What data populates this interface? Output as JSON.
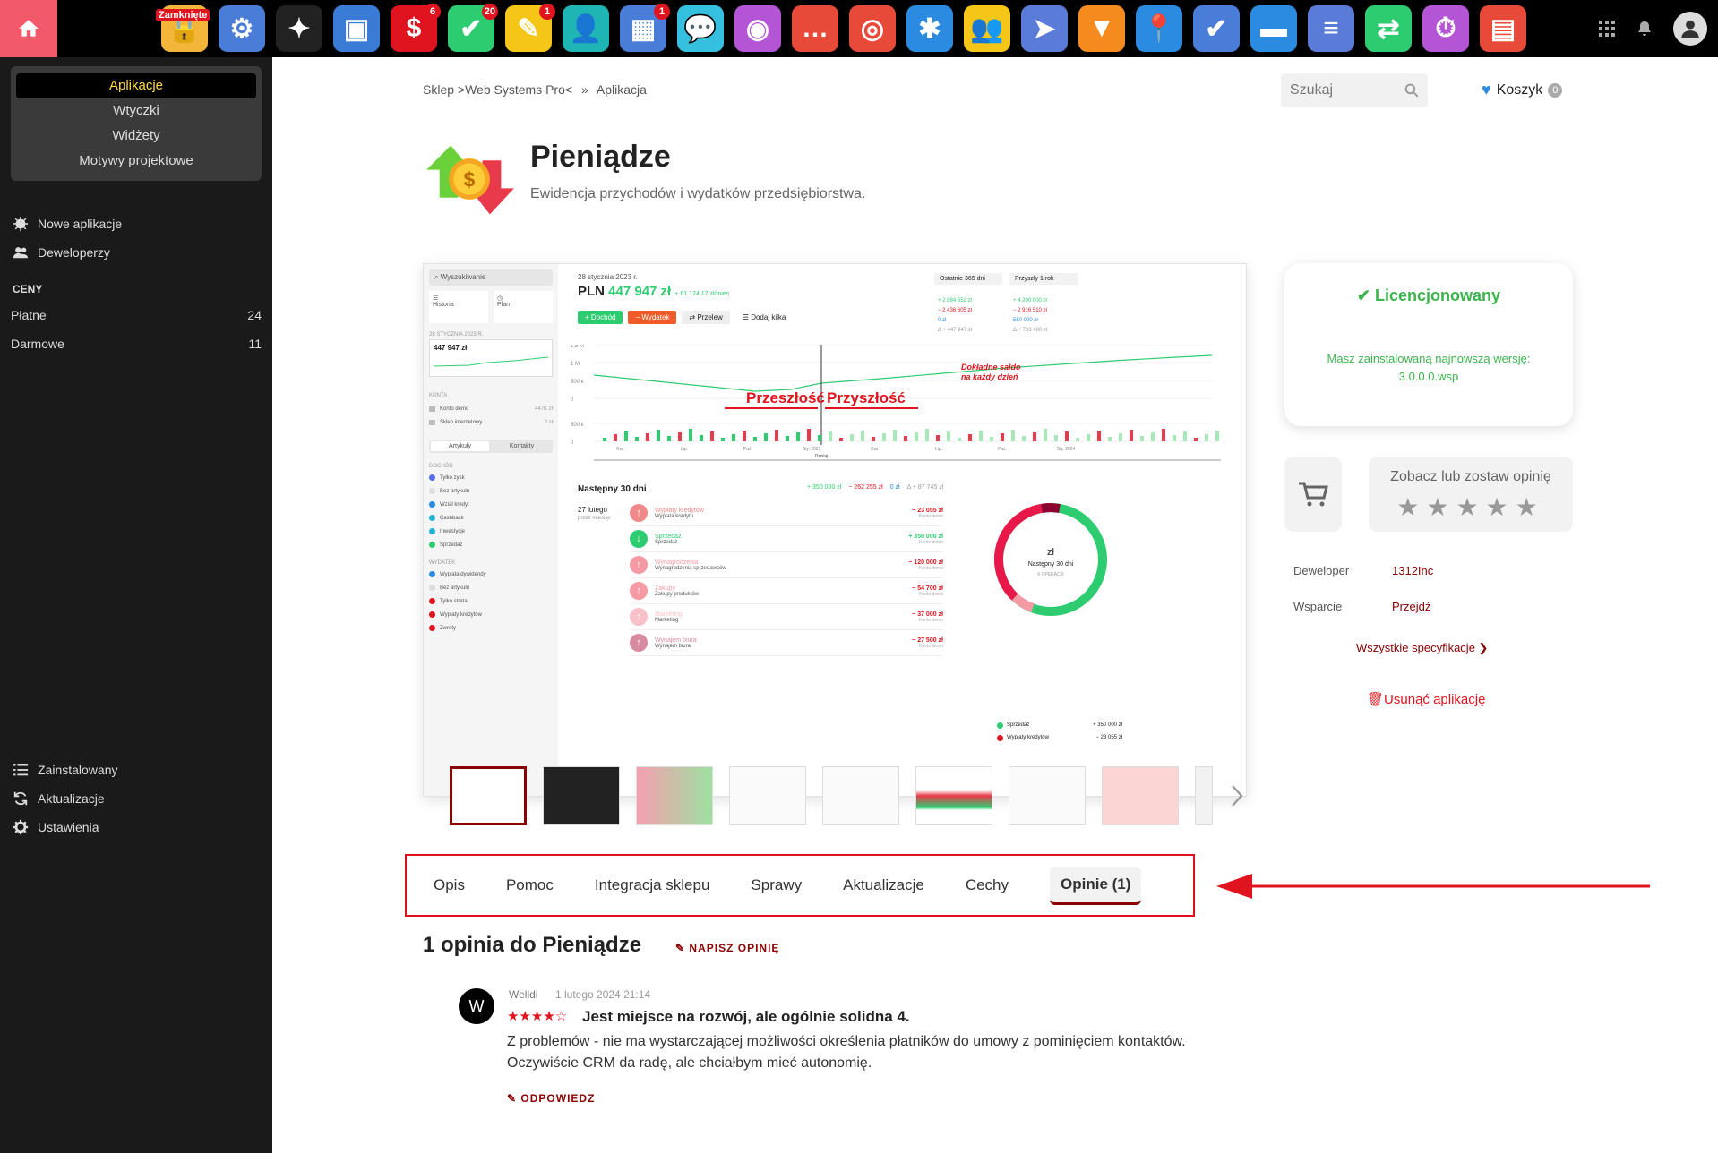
{
  "topbar": {
    "closed_label": "Zamknięte",
    "apps": [
      {
        "icon": "lock-app-icon",
        "color": "#f3b63b",
        "glyph": "🔒",
        "badge": ""
      },
      {
        "icon": "gear-app-icon",
        "color": "#4a7dd8",
        "glyph": "⚙",
        "badge": ""
      },
      {
        "icon": "magic-wand-app-icon",
        "color": "#222",
        "glyph": "✦",
        "badge": ""
      },
      {
        "icon": "window-settings-app-icon",
        "color": "#3a7bd5",
        "glyph": "▣",
        "badge": ""
      },
      {
        "icon": "dollar-app-icon",
        "color": "#e0141e",
        "glyph": "$",
        "badge": "6"
      },
      {
        "icon": "download-tasks-app-icon",
        "color": "#2ecc71",
        "glyph": "✔",
        "badge": "20"
      },
      {
        "icon": "pencil-notes-app-icon",
        "color": "#f5c518",
        "glyph": "✎",
        "badge": "1"
      },
      {
        "icon": "contact-book-app-icon",
        "color": "#1fb5b5",
        "glyph": "👤",
        "badge": ""
      },
      {
        "icon": "calendar-app-icon",
        "color": "#4a7dd8",
        "glyph": "▦",
        "badge": "1"
      },
      {
        "icon": "chat-app-icon",
        "color": "#35c0e0",
        "glyph": "💬",
        "badge": ""
      },
      {
        "icon": "camera-app-icon",
        "color": "#b455d6",
        "glyph": "◉",
        "badge": ""
      },
      {
        "icon": "messages-app-icon",
        "color": "#e84a3a",
        "glyph": "…",
        "badge": ""
      },
      {
        "icon": "lifebuoy-app-icon",
        "color": "#e84a3a",
        "glyph": "◎",
        "badge": ""
      },
      {
        "icon": "medical-doc-app-icon",
        "color": "#2a8be0",
        "glyph": "✱",
        "badge": ""
      },
      {
        "icon": "team-app-icon",
        "color": "#f5c518",
        "glyph": "👥",
        "badge": ""
      },
      {
        "icon": "paper-plane-app-icon",
        "color": "#5b7bd8",
        "glyph": "➤",
        "badge": ""
      },
      {
        "icon": "funnel-app-icon",
        "color": "#f58a1f",
        "glyph": "▼",
        "badge": ""
      },
      {
        "icon": "map-pin-app-icon",
        "color": "#2a8be0",
        "glyph": "📍",
        "badge": ""
      },
      {
        "icon": "double-check-app-icon",
        "color": "#4a7dd8",
        "glyph": "✔",
        "badge": ""
      },
      {
        "icon": "folder-app-icon",
        "color": "#2a8be0",
        "glyph": "▬",
        "badge": ""
      },
      {
        "icon": "document-edit-app-icon",
        "color": "#5b7bd8",
        "glyph": "≡",
        "badge": ""
      },
      {
        "icon": "money-arrows-app-icon",
        "color": "#2ecc71",
        "glyph": "⇄",
        "badge": ""
      },
      {
        "icon": "stopwatch-app-icon",
        "color": "#b455d6",
        "glyph": "⏱",
        "badge": ""
      },
      {
        "icon": "sitemap-app-icon",
        "color": "#e84a3a",
        "glyph": "▤",
        "badge": ""
      }
    ]
  },
  "sidebar": {
    "categories": [
      "Aplikacje",
      "Wtyczki",
      "Widżety",
      "Motywy projektowe"
    ],
    "nav": [
      {
        "label": "Nowe aplikacje",
        "icon": "sparkle-icon"
      },
      {
        "label": "Deweloperzy",
        "icon": "users-icon"
      }
    ],
    "prices_title": "CENY",
    "prices": [
      {
        "label": "Płatne",
        "count": "24"
      },
      {
        "label": "Darmowe",
        "count": "11"
      }
    ],
    "bottom": [
      {
        "label": "Zainstalowany",
        "icon": "list-icon"
      },
      {
        "label": "Aktualizacje",
        "icon": "refresh-icon"
      },
      {
        "label": "Ustawienia",
        "icon": "gear-icon"
      }
    ]
  },
  "header": {
    "breadcrumb_1": "Sklep >Web Systems Pro<",
    "breadcrumb_sep": "»",
    "breadcrumb_2": "Aplikacja",
    "search_placeholder": "Szukaj",
    "cart_label": "Koszyk",
    "cart_count": "0"
  },
  "app": {
    "title": "Pieniądze",
    "subtitle": "Ewidencja przychodów i wydatków przedsiębiorstwa."
  },
  "screenshot": {
    "search": "Wyszukiwanie",
    "nav_history": "Historia",
    "nav_plan": "Plan",
    "date_small": "28 STYCZNIA 2023 R.",
    "balance_small": "447 947 zł",
    "accounts_title": "KONTA",
    "accounts": [
      {
        "name": "Konto demo",
        "amount": "447K zł"
      },
      {
        "name": "Sklep internetowy",
        "amount": "0 zł"
      }
    ],
    "seg_articles": "Artykuły",
    "seg_contacts": "Kontakty",
    "income_title": "DOCHÓD",
    "income": [
      {
        "name": "Tylko zysk",
        "color": "#5b6be8"
      },
      {
        "name": "Bez artykułu",
        "color": "#ddd"
      },
      {
        "name": "Wziął kredyt",
        "color": "#2a8be0"
      },
      {
        "name": "Cashback",
        "color": "#1fb5d0"
      },
      {
        "name": "Inwestycje",
        "color": "#1fb5d0"
      },
      {
        "name": "Sprzedaż",
        "color": "#2ecc71"
      }
    ],
    "expenses_title": "WYDATEK",
    "expenses": [
      {
        "name": "Wypłata dywidendy",
        "color": "#2a8be0"
      },
      {
        "name": "Bez artykułu",
        "color": "#ddd"
      },
      {
        "name": "Tylko strata",
        "color": "#e0141e"
      },
      {
        "name": "Wypłaty kredytów",
        "color": "#e0141e"
      },
      {
        "name": "Zwroty",
        "color": "#e0141e"
      }
    ],
    "date": "28 stycznia 2023 r.",
    "currency": "PLN",
    "balance": "447 947 zł",
    "rate": "+ 61 124,17 zł/mies.",
    "btn_income": "+ Dochód",
    "btn_expense": "− Wydatek",
    "btn_transfer": "⇄ Przelew",
    "btn_add_many": "☰ Dodaj kilka",
    "dd_left": "Ostatnie 365 dni",
    "dd_right": "Przyszły 1 rok",
    "stats_left": [
      "+ 2 884 552 zł",
      "− 2 436 605 zł",
      "0 zł",
      "Δ + 447 947 zł"
    ],
    "stats_right": [
      "+ 4 200 000 zł",
      "− 2 916 510 zł",
      "550 000 zł",
      "Δ + 733 490 zł"
    ],
    "y_ticks": [
      "1,5 M",
      "1 M",
      "500 k",
      "0",
      "500 k",
      "0"
    ],
    "x_ticks": [
      "Kwi.",
      "Lip.",
      "Paź.",
      "Sty. 2023",
      "Kwi.",
      "Lip.",
      "Paź.",
      "Sty. 2024"
    ],
    "today": "Dzisiaj",
    "past": "Przeszłość",
    "future": "Przyszłość",
    "note_line1": "Dokładne saldo",
    "note_line2": "na każdy dzień",
    "next30": "Następny 30 dni",
    "summary": [
      "+ 350 000 zł",
      "− 262 255 zł",
      "0 zł",
      "Δ + 87 745 zł"
    ],
    "date_27": "27 lutego",
    "date_27_sub": "przez miesiąc",
    "transactions": [
      {
        "name": "Wypłaty kredytów",
        "sub": "Wypłata kredytu",
        "amount": "− 23 055 zł",
        "account": "Konto demo",
        "color": "#f08a8a",
        "arrow": "↑"
      },
      {
        "name": "Sprzedaż",
        "sub": "Sprzedaż",
        "amount": "+ 350 000 zł",
        "account": "Konto demo",
        "color": "#2ecc71",
        "arrow": "↓"
      },
      {
        "name": "Wynagrodzenia",
        "sub": "Wynagrodzenia sprzedawców",
        "amount": "− 120 000 zł",
        "account": "Konto demo",
        "color": "#f59aa4",
        "arrow": "↑"
      },
      {
        "name": "Zakupy",
        "sub": "Zakupy produktów",
        "amount": "− 54 700 zł",
        "account": "Konto demo",
        "color": "#f59aa4",
        "arrow": "↑"
      },
      {
        "name": "Marketing",
        "sub": "Marketing",
        "amount": "− 37 000 zł",
        "account": "Konto demo",
        "color": "#f8c0c8",
        "arrow": "↑"
      },
      {
        "name": "Wynajem biura",
        "sub": "Wynajem biura",
        "amount": "− 27 500 zł",
        "account": "Konto demo",
        "color": "#d88aa0",
        "arrow": "↑"
      }
    ],
    "donut_center": "zł",
    "donut_sub": "Następny 30 dni",
    "donut_sub2": "6 OPERACJI",
    "legend": [
      {
        "name": "Sprzedaż",
        "amount": "+ 350 000 zł",
        "color": "#2ecc71"
      },
      {
        "name": "Wypłaty kredytów",
        "amount": "− 23 055 zł",
        "color": "#e0141e"
      }
    ]
  },
  "tabs": [
    "Opis",
    "Pomoc",
    "Integracja sklepu",
    "Sprawy",
    "Aktualizacje",
    "Cechy",
    "Opinie (1)"
  ],
  "license": {
    "title": "Licencjonowany",
    "message": "Masz zainstalowaną najnowszą wersję:",
    "version": "3.0.0.0.wsp"
  },
  "review_button": {
    "label": "Zobacz lub zostaw opinię",
    "stars": "★★★★★"
  },
  "specs": {
    "developer_label": "Deweloper",
    "developer_value": "1312Inc",
    "support_label": "Wsparcie",
    "support_value": "Przejdź",
    "all_specs": "Wszystkie specyfikacje ❯",
    "remove": "Usunąć aplikację"
  },
  "reviews": {
    "heading": "1 opinia do Pieniądze",
    "write": "NAPISZ OPINIĘ",
    "items": [
      {
        "initial": "W",
        "author": "Welldi",
        "date": "1 lutego 2024 21:14",
        "stars": "★★★★☆",
        "rating": 4,
        "title": "Jest miejsce na rozwój, ale ogólnie solidna 4.",
        "body_1": "Z problemów - nie ma wystarczającej możliwości określenia płatników do umowy z pominięciem kontaktów.",
        "body_2": "Oczywiście CRM da radę, ale chciałbym mieć autonomię.",
        "reply": "ODPOWIEDZ"
      }
    ]
  }
}
